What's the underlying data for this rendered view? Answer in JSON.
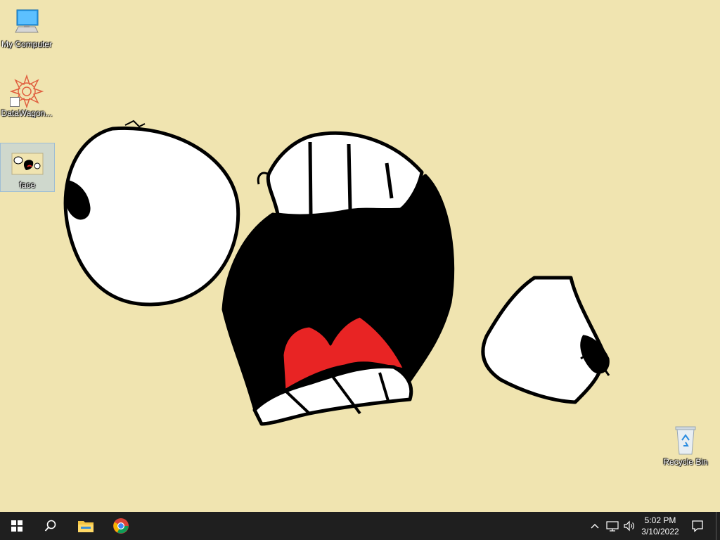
{
  "desktop": {
    "background_color": "#f0e4b0",
    "icons": [
      {
        "label": "My Computer",
        "icon": "computer-icon"
      },
      {
        "label": "DataWagon...",
        "icon": "datawagon-icon"
      },
      {
        "label": "face",
        "icon": "image-file-icon",
        "selected": true
      },
      {
        "label": "Recycle Bin",
        "icon": "recycle-bin-icon"
      }
    ]
  },
  "taskbar": {
    "background_color": "#1f1f1f",
    "start": {
      "icon": "windows-start-icon"
    },
    "search": {
      "icon": "search-icon"
    },
    "pinned": [
      {
        "name": "File Explorer",
        "icon": "file-explorer-icon"
      },
      {
        "name": "Google Chrome",
        "icon": "chrome-icon"
      }
    ],
    "tray": {
      "icons": [
        "chevron-up-icon",
        "network-icon",
        "volume-icon"
      ],
      "time": "5:02 PM",
      "date": "3/10/2022",
      "notifications_icon": "notifications-icon"
    }
  }
}
